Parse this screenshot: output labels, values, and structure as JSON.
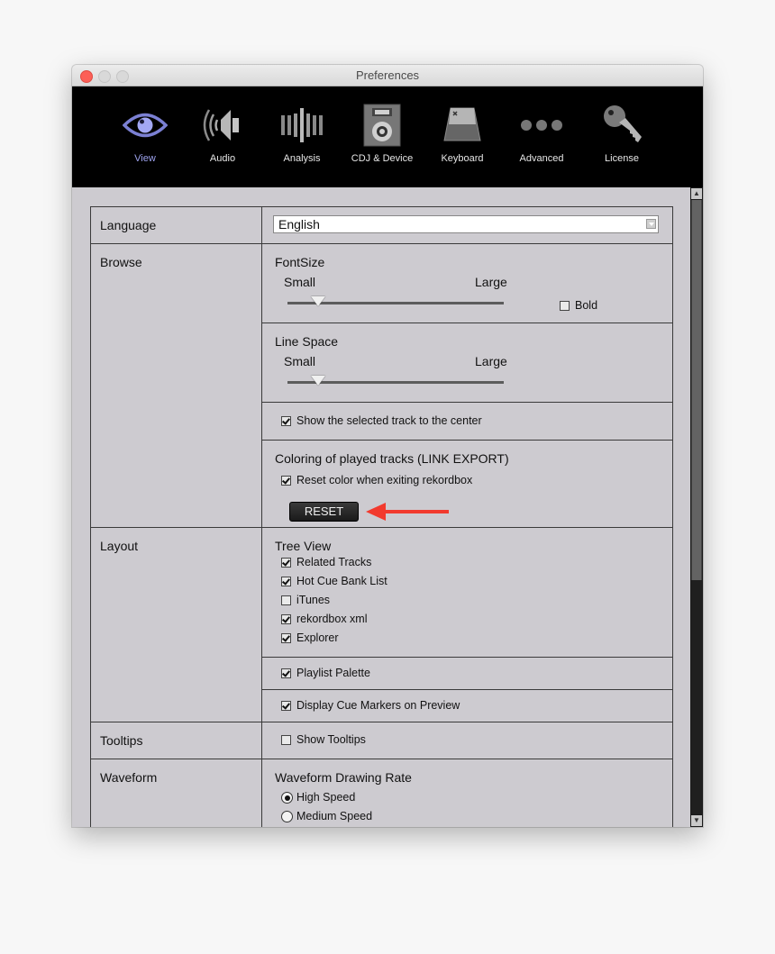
{
  "window": {
    "title": "Preferences"
  },
  "toolbar": {
    "items": [
      {
        "label": "View",
        "icon": "eye-icon",
        "active": true
      },
      {
        "label": "Audio",
        "icon": "speaker-icon",
        "active": false
      },
      {
        "label": "Analysis",
        "icon": "waveform-bars-icon",
        "active": false
      },
      {
        "label": "CDJ & Device",
        "icon": "cdj-device-icon",
        "active": false
      },
      {
        "label": "Keyboard",
        "icon": "keyboard-key-icon",
        "active": false
      },
      {
        "label": "Advanced",
        "icon": "ellipsis-icon",
        "active": false
      },
      {
        "label": "License",
        "icon": "key-icon",
        "active": false
      }
    ],
    "active_color": "#9ea3ef"
  },
  "language": {
    "label": "Language",
    "selected": "English"
  },
  "browse": {
    "label": "Browse",
    "fontsize": {
      "title": "FontSize",
      "min_label": "Small",
      "max_label": "Large",
      "value_fraction": 0.14,
      "bold_label": "Bold",
      "bold_checked": false
    },
    "linespace": {
      "title": "Line Space",
      "min_label": "Small",
      "max_label": "Large",
      "value_fraction": 0.14
    },
    "center": {
      "label": "Show the selected track to the center",
      "checked": true
    },
    "coloring": {
      "title": "Coloring of played tracks  (LINK EXPORT)",
      "reset_color_label": "Reset color when exiting rekordbox",
      "reset_color_checked": true,
      "reset_button": "RESET",
      "annotation_arrow_color": "#f23a2e"
    }
  },
  "layout": {
    "label": "Layout",
    "tree_view": {
      "title": "Tree View",
      "items": [
        {
          "label": "Related Tracks",
          "checked": true
        },
        {
          "label": "Hot Cue Bank List",
          "checked": true
        },
        {
          "label": "iTunes",
          "checked": false
        },
        {
          "label": "rekordbox xml",
          "checked": true
        },
        {
          "label": "Explorer",
          "checked": true
        }
      ]
    },
    "playlist_palette": {
      "label": "Playlist Palette",
      "checked": true
    },
    "cue_markers": {
      "label": "Display Cue Markers on Preview",
      "checked": true
    }
  },
  "tooltips": {
    "label": "Tooltips",
    "show_label": "Show Tooltips",
    "checked": false
  },
  "waveform": {
    "label": "Waveform",
    "title": "Waveform Drawing Rate",
    "options": [
      {
        "label": "High Speed",
        "selected": true
      },
      {
        "label": "Medium Speed",
        "selected": false
      }
    ]
  }
}
